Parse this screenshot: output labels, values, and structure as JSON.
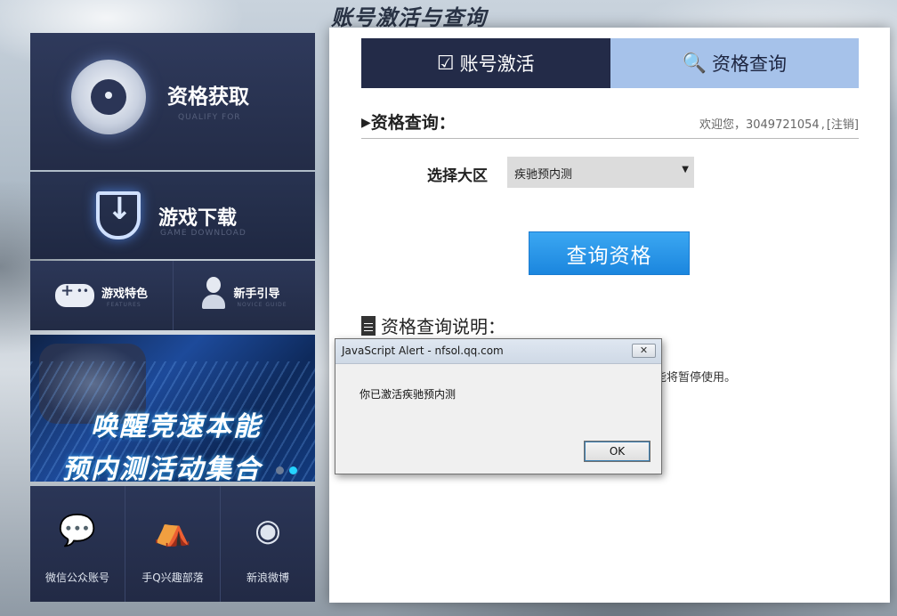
{
  "page": {
    "heading": "账号激活与查询"
  },
  "sidebar": {
    "qualify": {
      "label": "资格获取",
      "sub": "QUALIFY FOR"
    },
    "download": {
      "label": "游戏下载",
      "sub": "GAME DOWNLOAD"
    },
    "features": {
      "label": "游戏特色",
      "sub": "FEATURES"
    },
    "guide": {
      "label": "新手引导",
      "sub": "NOVICE GUIDE"
    },
    "banner": {
      "line1": "唤醒竞速本能",
      "line2": "预内测活动集合"
    },
    "social": [
      {
        "label": "微信公众账号",
        "icon": "wechat-icon"
      },
      {
        "label": "手Q兴趣部落",
        "icon": "tent-icon"
      },
      {
        "label": "新浪微博",
        "icon": "weibo-icon"
      }
    ]
  },
  "panel": {
    "tabs": [
      {
        "label": "账号激活",
        "icon": "checkbox-icon"
      },
      {
        "label": "资格查询",
        "icon": "search-icon"
      }
    ],
    "section_title": "资格查询：",
    "welcome_prefix": "欢迎您，",
    "user_id": "3049721054",
    "logout": "[注销]",
    "region_label": "选择大区",
    "region_value": "疾驰预内测",
    "query_button": "查询资格",
    "desc_title": "资格查询说明：",
    "desc_visible_fragment": "能将暂停使用。"
  },
  "alert": {
    "title": "JavaScript Alert - nfsol.qq.com",
    "close": "✕",
    "message": "你已激活疾驰预内测",
    "ok": "OK"
  },
  "colors": {
    "tab_active_bg": "#232b48",
    "tab_inactive_bg": "#a6c2ea",
    "button_blue": "#1b86de",
    "sidebar_navy": "#2b3657"
  }
}
